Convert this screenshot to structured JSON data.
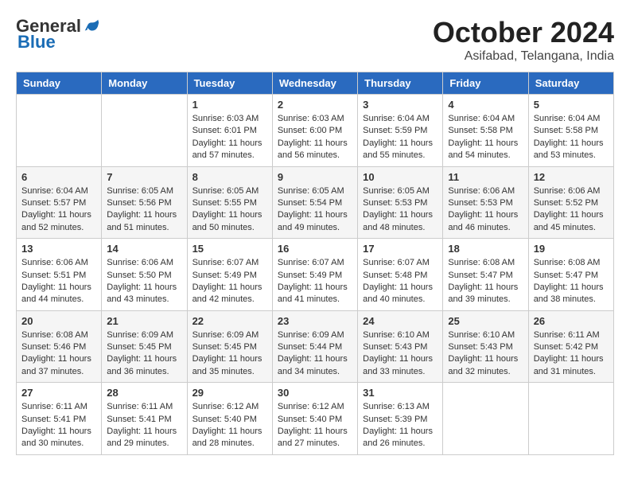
{
  "logo": {
    "general": "General",
    "blue": "Blue"
  },
  "title": "October 2024",
  "location": "Asifabad, Telangana, India",
  "days_of_week": [
    "Sunday",
    "Monday",
    "Tuesday",
    "Wednesday",
    "Thursday",
    "Friday",
    "Saturday"
  ],
  "weeks": [
    [
      {
        "day": "",
        "sunrise": "",
        "sunset": "",
        "daylight": ""
      },
      {
        "day": "",
        "sunrise": "",
        "sunset": "",
        "daylight": ""
      },
      {
        "day": "1",
        "sunrise": "Sunrise: 6:03 AM",
        "sunset": "Sunset: 6:01 PM",
        "daylight": "Daylight: 11 hours and 57 minutes."
      },
      {
        "day": "2",
        "sunrise": "Sunrise: 6:03 AM",
        "sunset": "Sunset: 6:00 PM",
        "daylight": "Daylight: 11 hours and 56 minutes."
      },
      {
        "day": "3",
        "sunrise": "Sunrise: 6:04 AM",
        "sunset": "Sunset: 5:59 PM",
        "daylight": "Daylight: 11 hours and 55 minutes."
      },
      {
        "day": "4",
        "sunrise": "Sunrise: 6:04 AM",
        "sunset": "Sunset: 5:58 PM",
        "daylight": "Daylight: 11 hours and 54 minutes."
      },
      {
        "day": "5",
        "sunrise": "Sunrise: 6:04 AM",
        "sunset": "Sunset: 5:58 PM",
        "daylight": "Daylight: 11 hours and 53 minutes."
      }
    ],
    [
      {
        "day": "6",
        "sunrise": "Sunrise: 6:04 AM",
        "sunset": "Sunset: 5:57 PM",
        "daylight": "Daylight: 11 hours and 52 minutes."
      },
      {
        "day": "7",
        "sunrise": "Sunrise: 6:05 AM",
        "sunset": "Sunset: 5:56 PM",
        "daylight": "Daylight: 11 hours and 51 minutes."
      },
      {
        "day": "8",
        "sunrise": "Sunrise: 6:05 AM",
        "sunset": "Sunset: 5:55 PM",
        "daylight": "Daylight: 11 hours and 50 minutes."
      },
      {
        "day": "9",
        "sunrise": "Sunrise: 6:05 AM",
        "sunset": "Sunset: 5:54 PM",
        "daylight": "Daylight: 11 hours and 49 minutes."
      },
      {
        "day": "10",
        "sunrise": "Sunrise: 6:05 AM",
        "sunset": "Sunset: 5:53 PM",
        "daylight": "Daylight: 11 hours and 48 minutes."
      },
      {
        "day": "11",
        "sunrise": "Sunrise: 6:06 AM",
        "sunset": "Sunset: 5:53 PM",
        "daylight": "Daylight: 11 hours and 46 minutes."
      },
      {
        "day": "12",
        "sunrise": "Sunrise: 6:06 AM",
        "sunset": "Sunset: 5:52 PM",
        "daylight": "Daylight: 11 hours and 45 minutes."
      }
    ],
    [
      {
        "day": "13",
        "sunrise": "Sunrise: 6:06 AM",
        "sunset": "Sunset: 5:51 PM",
        "daylight": "Daylight: 11 hours and 44 minutes."
      },
      {
        "day": "14",
        "sunrise": "Sunrise: 6:06 AM",
        "sunset": "Sunset: 5:50 PM",
        "daylight": "Daylight: 11 hours and 43 minutes."
      },
      {
        "day": "15",
        "sunrise": "Sunrise: 6:07 AM",
        "sunset": "Sunset: 5:49 PM",
        "daylight": "Daylight: 11 hours and 42 minutes."
      },
      {
        "day": "16",
        "sunrise": "Sunrise: 6:07 AM",
        "sunset": "Sunset: 5:49 PM",
        "daylight": "Daylight: 11 hours and 41 minutes."
      },
      {
        "day": "17",
        "sunrise": "Sunrise: 6:07 AM",
        "sunset": "Sunset: 5:48 PM",
        "daylight": "Daylight: 11 hours and 40 minutes."
      },
      {
        "day": "18",
        "sunrise": "Sunrise: 6:08 AM",
        "sunset": "Sunset: 5:47 PM",
        "daylight": "Daylight: 11 hours and 39 minutes."
      },
      {
        "day": "19",
        "sunrise": "Sunrise: 6:08 AM",
        "sunset": "Sunset: 5:47 PM",
        "daylight": "Daylight: 11 hours and 38 minutes."
      }
    ],
    [
      {
        "day": "20",
        "sunrise": "Sunrise: 6:08 AM",
        "sunset": "Sunset: 5:46 PM",
        "daylight": "Daylight: 11 hours and 37 minutes."
      },
      {
        "day": "21",
        "sunrise": "Sunrise: 6:09 AM",
        "sunset": "Sunset: 5:45 PM",
        "daylight": "Daylight: 11 hours and 36 minutes."
      },
      {
        "day": "22",
        "sunrise": "Sunrise: 6:09 AM",
        "sunset": "Sunset: 5:45 PM",
        "daylight": "Daylight: 11 hours and 35 minutes."
      },
      {
        "day": "23",
        "sunrise": "Sunrise: 6:09 AM",
        "sunset": "Sunset: 5:44 PM",
        "daylight": "Daylight: 11 hours and 34 minutes."
      },
      {
        "day": "24",
        "sunrise": "Sunrise: 6:10 AM",
        "sunset": "Sunset: 5:43 PM",
        "daylight": "Daylight: 11 hours and 33 minutes."
      },
      {
        "day": "25",
        "sunrise": "Sunrise: 6:10 AM",
        "sunset": "Sunset: 5:43 PM",
        "daylight": "Daylight: 11 hours and 32 minutes."
      },
      {
        "day": "26",
        "sunrise": "Sunrise: 6:11 AM",
        "sunset": "Sunset: 5:42 PM",
        "daylight": "Daylight: 11 hours and 31 minutes."
      }
    ],
    [
      {
        "day": "27",
        "sunrise": "Sunrise: 6:11 AM",
        "sunset": "Sunset: 5:41 PM",
        "daylight": "Daylight: 11 hours and 30 minutes."
      },
      {
        "day": "28",
        "sunrise": "Sunrise: 6:11 AM",
        "sunset": "Sunset: 5:41 PM",
        "daylight": "Daylight: 11 hours and 29 minutes."
      },
      {
        "day": "29",
        "sunrise": "Sunrise: 6:12 AM",
        "sunset": "Sunset: 5:40 PM",
        "daylight": "Daylight: 11 hours and 28 minutes."
      },
      {
        "day": "30",
        "sunrise": "Sunrise: 6:12 AM",
        "sunset": "Sunset: 5:40 PM",
        "daylight": "Daylight: 11 hours and 27 minutes."
      },
      {
        "day": "31",
        "sunrise": "Sunrise: 6:13 AM",
        "sunset": "Sunset: 5:39 PM",
        "daylight": "Daylight: 11 hours and 26 minutes."
      },
      {
        "day": "",
        "sunrise": "",
        "sunset": "",
        "daylight": ""
      },
      {
        "day": "",
        "sunrise": "",
        "sunset": "",
        "daylight": ""
      }
    ]
  ]
}
